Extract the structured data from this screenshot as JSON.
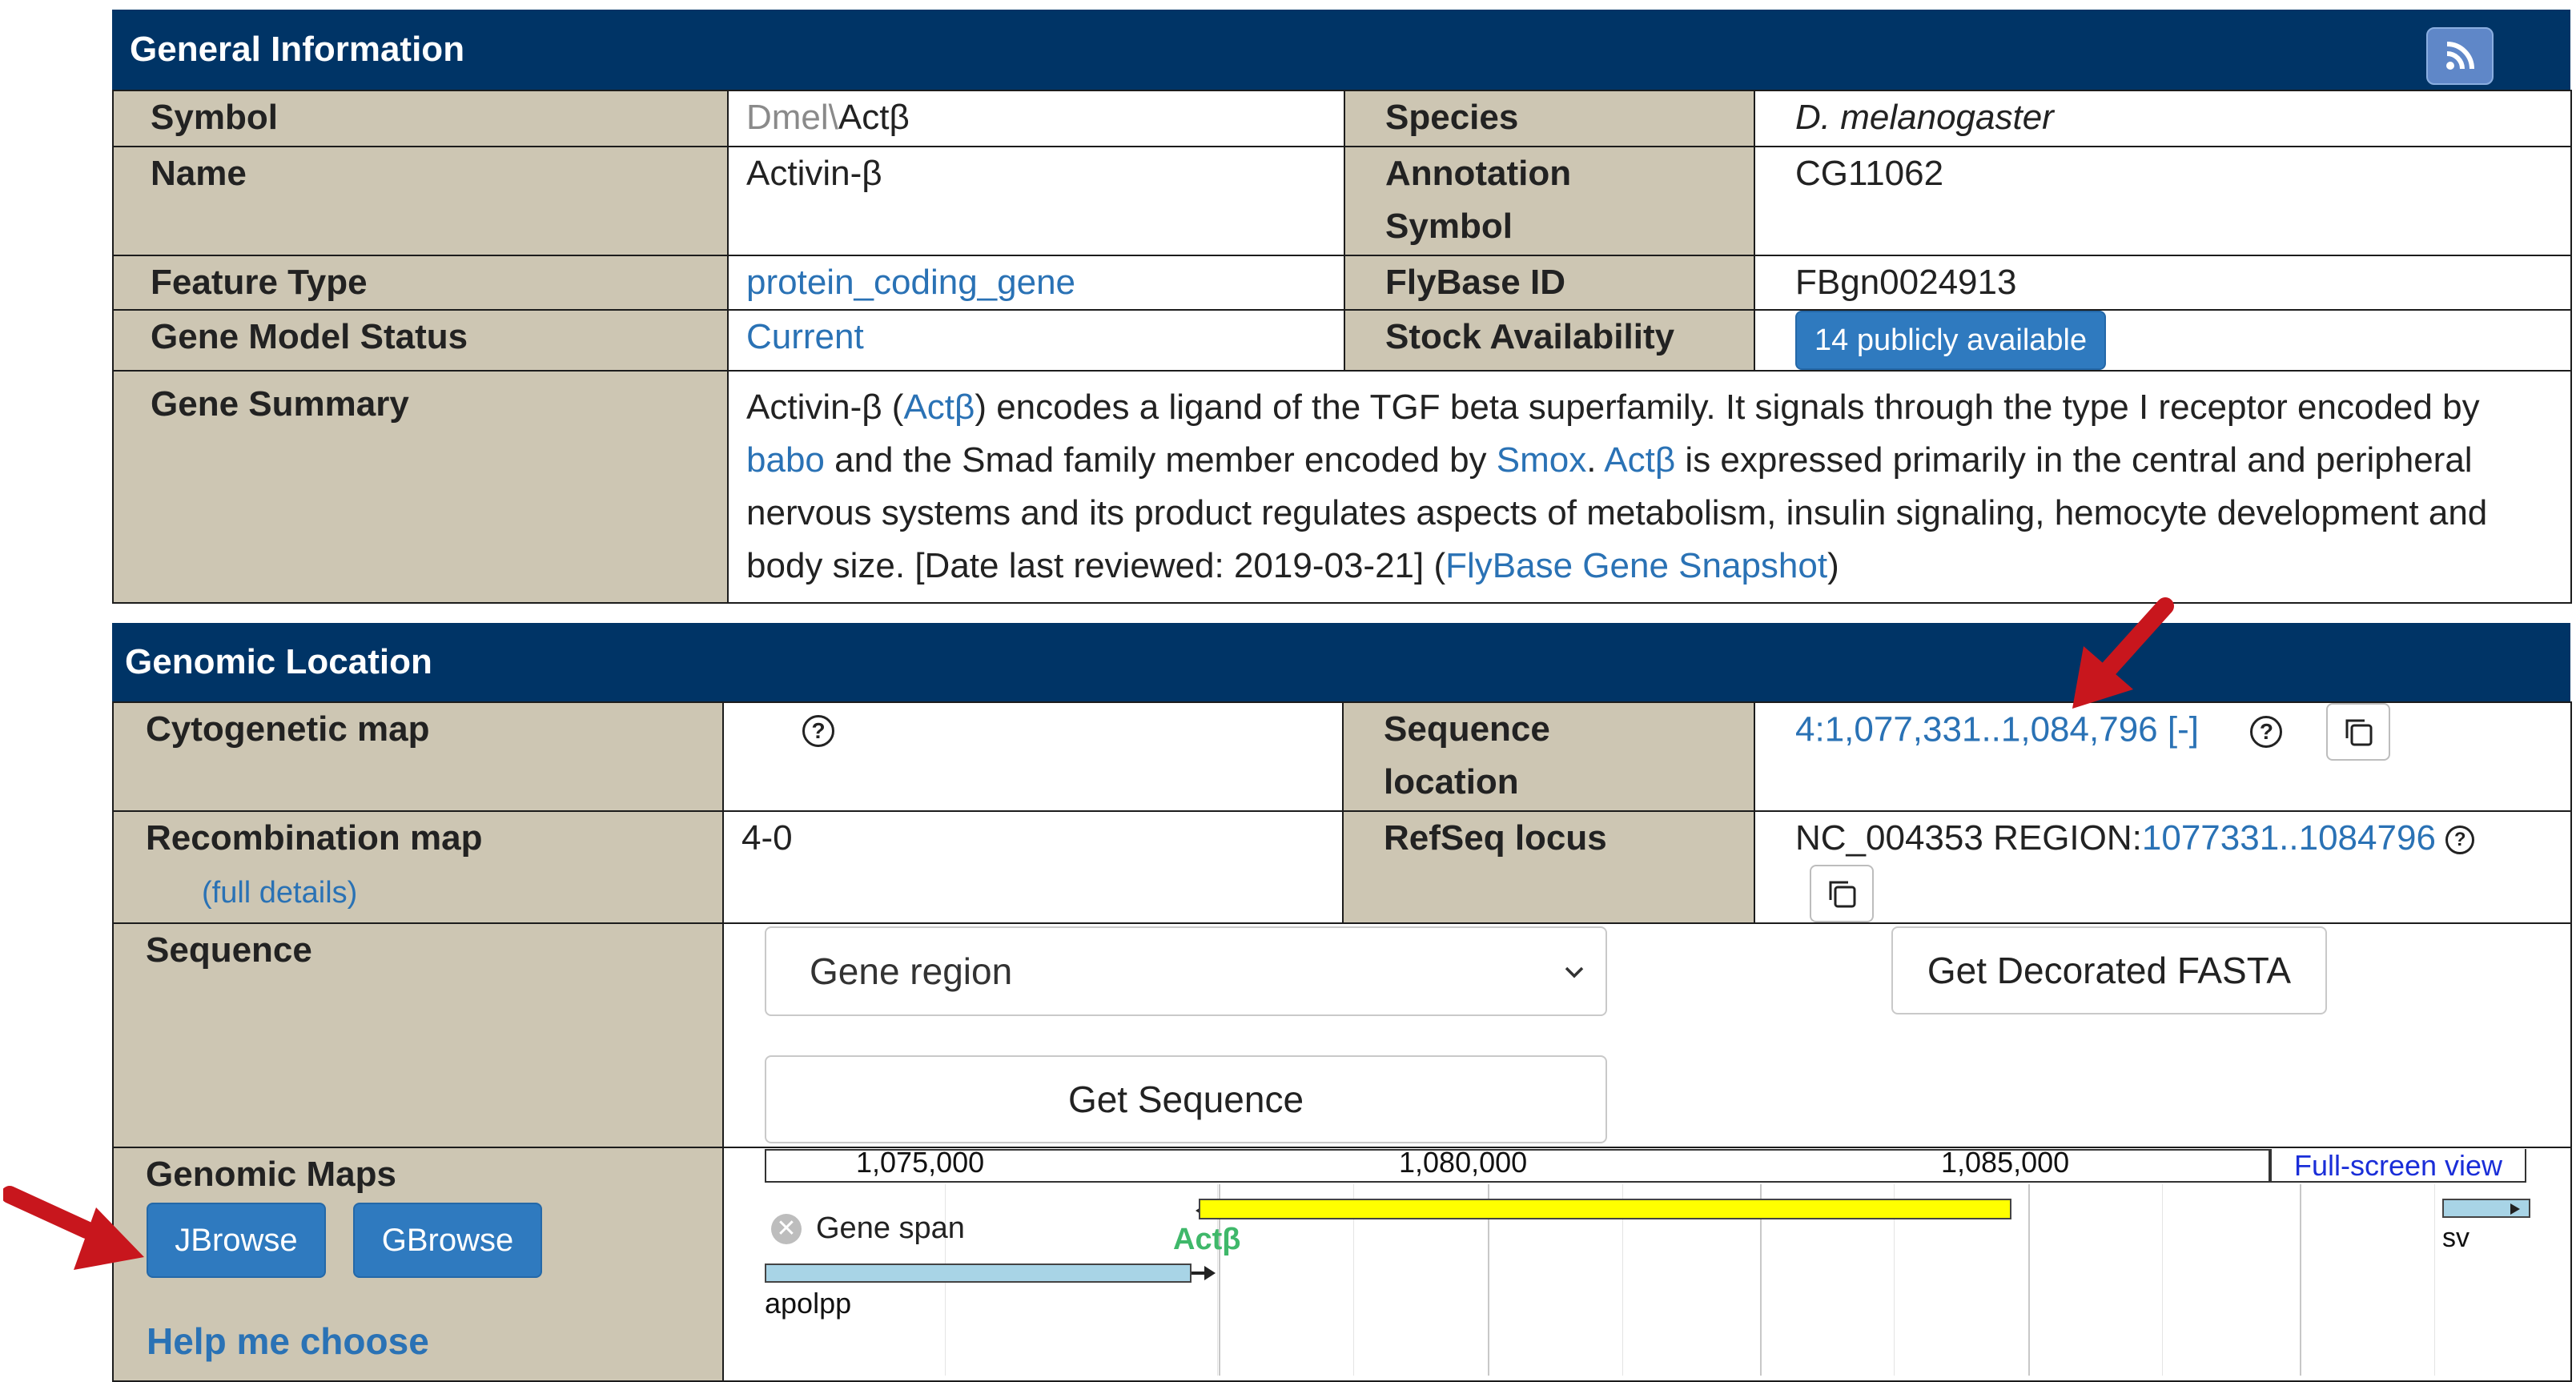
{
  "general": {
    "header": "General Information",
    "rss_icon": "rss-icon",
    "symbol_label": "Symbol",
    "symbol_prefix": "Dmel\\",
    "symbol_value": "Actβ",
    "species_label": "Species",
    "species_value": "D. melanogaster",
    "name_label": "Name",
    "name_value": "Activin-β",
    "annotation_label_1": "Annotation",
    "annotation_label_2": "Symbol",
    "annotation_value": "CG11062",
    "feature_type_label": "Feature Type",
    "feature_type_value": "protein_coding_gene",
    "flybase_id_label": "FlyBase ID",
    "flybase_id_value": "FBgn0024913",
    "gene_model_label": "Gene Model Status",
    "gene_model_value": "Current",
    "stock_label": "Stock Availability",
    "stock_value": "14 publicly available",
    "summary_label": "Gene Summary",
    "summary": {
      "p1": "Activin-β (",
      "l1": "Actβ",
      "p2": ") encodes a ligand of the TGF beta superfamily. It signals through the type I receptor encoded by ",
      "l2": "babo",
      "p3": " and the Smad family member encoded by ",
      "l3": "Smox",
      "p4": ". ",
      "l4": "Actβ",
      "p5": " is expressed primarily in the central and peripheral nervous systems and its product regulates aspects of metabolism, insulin signaling, hemocyte development and body size. [Date last reviewed: 2019-03-21] (",
      "l5": "FlyBase Gene Snapshot",
      "p6": ")"
    }
  },
  "genomic": {
    "header": "Genomic Location",
    "cyto_label": "Cytogenetic map",
    "seq_loc_label_1": "Sequence",
    "seq_loc_label_2": "location",
    "seq_loc_value": "4:1,077,331..1,084,796 [-]",
    "recomb_label": "Recombination map",
    "recomb_details": "(full details)",
    "recomb_value": "4-0",
    "refseq_label": "RefSeq locus",
    "refseq_prefix": "NC_004353 REGION:",
    "refseq_link": "1077331..1084796",
    "sequence_label": "Sequence",
    "sequence_select": "Gene region",
    "decorated_fasta": "Get Decorated FASTA",
    "get_sequence": "Get Sequence",
    "maps_label": "Genomic Maps",
    "jbrowse": "JBrowse",
    "gbrowse": "GBrowse",
    "help_choose": "Help me choose",
    "help_icon": "?"
  },
  "track": {
    "ticks": [
      "1,075,000",
      "1,080,000",
      "1,085,000"
    ],
    "fullscreen": "Full-screen view",
    "gene_span": "Gene span",
    "gene_label": "Actβ",
    "apolpp_label": "apolpp",
    "sv_label": "sv",
    "gene_color": "#ffff00",
    "neighbor_color": "#a8d4e6",
    "gene_label_color": "#3fb86a"
  },
  "colors": {
    "header_bg": "#003466",
    "label_bg": "#cdc6b3",
    "link": "#2a72b5",
    "button": "#2f7abf",
    "annotation_arrow": "#c8161d"
  }
}
